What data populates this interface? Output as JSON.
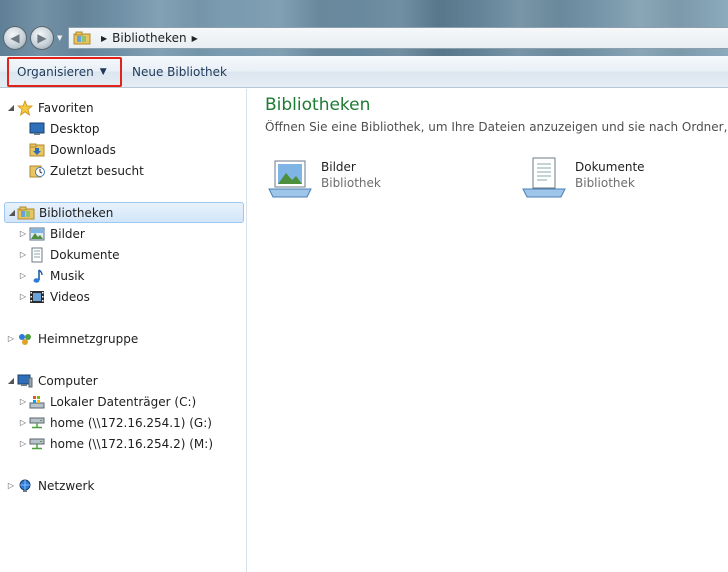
{
  "address": {
    "segments": [
      "Bibliotheken"
    ]
  },
  "toolbar": {
    "organize_label": "Organisieren",
    "new_library_label": "Neue Bibliothek"
  },
  "navigation": {
    "favorites": {
      "label": "Favoriten",
      "items": [
        "Desktop",
        "Downloads",
        "Zuletzt besucht"
      ]
    },
    "libraries": {
      "label": "Bibliotheken",
      "items": [
        "Bilder",
        "Dokumente",
        "Musik",
        "Videos"
      ]
    },
    "homegroup": {
      "label": "Heimnetzgruppe"
    },
    "computer": {
      "label": "Computer",
      "items": [
        "Lokaler Datenträger (C:)",
        "home (\\\\172.16.254.1) (G:)",
        "home (\\\\172.16.254.2) (M:)"
      ]
    },
    "network": {
      "label": "Netzwerk"
    }
  },
  "content": {
    "title": "Bibliotheken",
    "subtitle": "Öffnen Sie eine Bibliothek, um Ihre Dateien anzuzeigen und sie nach Ordner, Datum und",
    "items": [
      {
        "name": "Bilder",
        "type": "Bibliothek"
      },
      {
        "name": "Dokumente",
        "type": "Bibliothek"
      }
    ]
  },
  "colors": {
    "accent_green": "#1e7b34",
    "selection": "#d2e6fa",
    "highlight_border": "#e2231a"
  }
}
